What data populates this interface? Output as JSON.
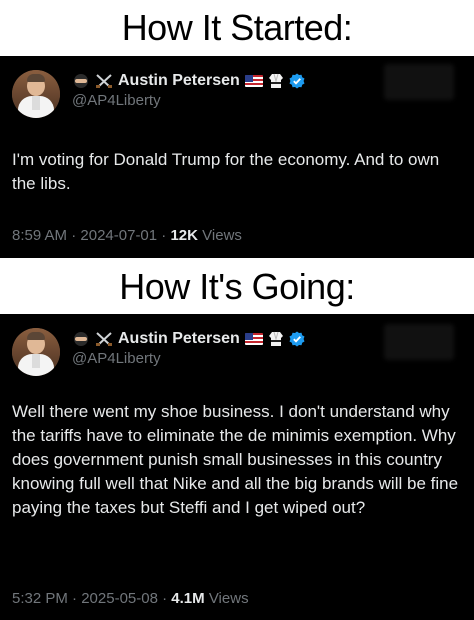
{
  "captions": {
    "top": "How It Started:",
    "bottom": "How It's Going:"
  },
  "tweets": [
    {
      "display_name": "Austin Petersen",
      "handle": "@AP4Liberty",
      "text": "I'm voting for Donald Trump for the economy. And to own the libs.",
      "time": "8:59 AM",
      "date": "2024-07-01",
      "views_count": "12K",
      "views_label": "Views",
      "name_emojis": [
        "ninja-emoji",
        "crossed-swords-emoji"
      ],
      "badge_emojis": [
        "us-flag-emoji",
        "martial-arts-uniform-emoji",
        "verified-badge"
      ]
    },
    {
      "display_name": "Austin Petersen",
      "handle": "@AP4Liberty",
      "text": "Well there went my shoe business. I don't understand why the tariffs have to eliminate the de minimis exemption. Why does government punish small businesses in this country knowing full well that Nike and all the big brands will be fine paying the taxes but Steffi and I get wiped out?",
      "time": "5:32 PM",
      "date": "2025-05-08",
      "views_count": "4.1M",
      "views_label": "Views",
      "name_emojis": [
        "ninja-emoji",
        "crossed-swords-emoji"
      ],
      "badge_emojis": [
        "us-flag-emoji",
        "martial-arts-uniform-emoji",
        "verified-badge"
      ]
    }
  ],
  "colors": {
    "tweet_bg": "#000000",
    "text_primary": "#e7e9ea",
    "text_secondary": "#71767b",
    "verified_blue": "#1d9bf0"
  }
}
